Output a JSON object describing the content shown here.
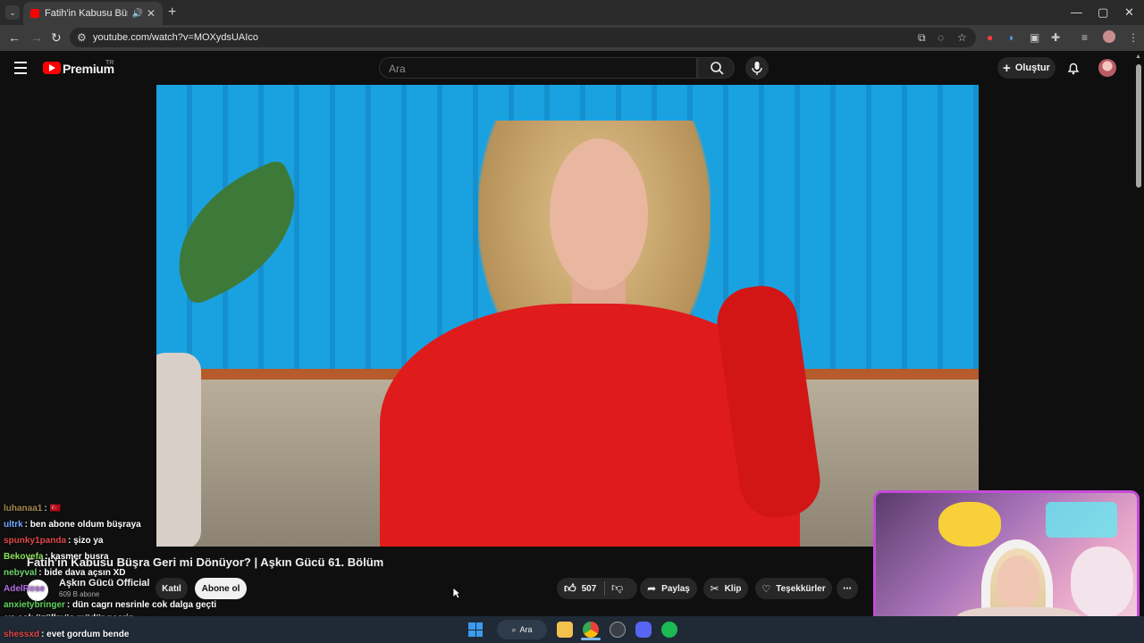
{
  "browser": {
    "tab_title": "Fatih'in Kabusu Büşra Geri ...",
    "url": "youtube.com/watch?v=MOXydsUAIco",
    "new_tab_symbol": "+",
    "tab_menu_symbol": "⌄",
    "window_controls": [
      "—",
      "▢",
      "✕"
    ]
  },
  "youtube": {
    "brand": "Premium",
    "country_badge": "TR",
    "search_placeholder": "Ara",
    "create_label": "Oluştur"
  },
  "video": {
    "title": "Fatih'in Kabusu Büşra Geri mi Dönüyor? | Aşkın Gücü 61. Bölüm",
    "channel_name": "Aşkın Gücü Official",
    "channel_subs": "609 B abone",
    "join_label": "Katıl",
    "subscribe_label": "Abone ol",
    "like_count": "507",
    "share_label": "Paylaş",
    "clip_label": "Klip",
    "thanks_label": "Teşekkürler"
  },
  "chat": [
    {
      "user": "luhanaa1",
      "text": ": 🇹🇷",
      "color": "#c8a35a"
    },
    {
      "user": "ultrk",
      "text": ": ben abone oldum büşraya",
      "color": "#6fa8ff"
    },
    {
      "user": "spunky1panda",
      "text": ": şizo ya",
      "color": "#e04848"
    },
    {
      "user": "Bekovefa",
      "text": ": kasmer busra",
      "color": "#8fe35a"
    },
    {
      "user": "nebyval",
      "text": ": bide dava açsın XD",
      "color": "#6fd36f"
    },
    {
      "user": "AdelRose",
      "text": "",
      "color": "#b46fe8"
    },
    {
      "user": "anxietybringer",
      "text": ": dün cagrı nesrinle cok dalga geçti",
      "color": "#5fd35f"
    },
    {
      "user": "",
      "text": "ya cok üzüllmüş müdür nesrin",
      "color": "#ffffff"
    },
    {
      "user": "shessxd",
      "text": ": evet gordum bende",
      "color": "#e04848"
    }
  ],
  "taskbar": {
    "search_label": "Ara"
  },
  "colors": {
    "youtube_red": "#ff0000",
    "webcam_border": "#c44bd6",
    "background": "#0f0f0f"
  }
}
